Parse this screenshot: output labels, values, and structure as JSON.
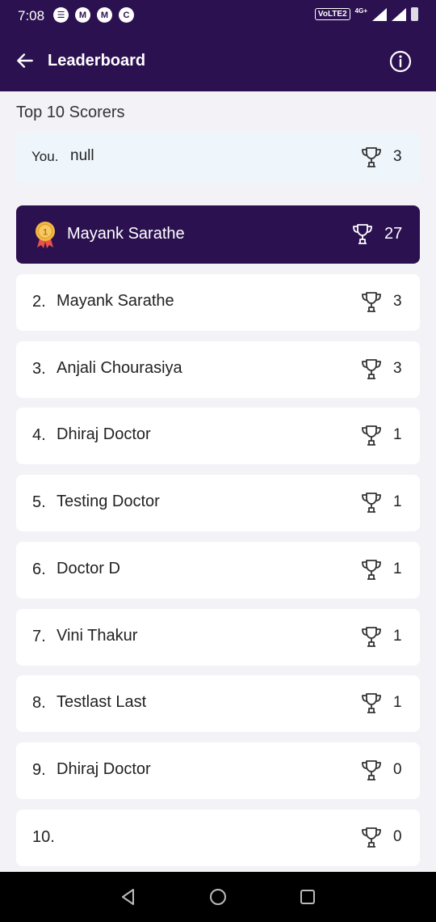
{
  "status_bar": {
    "time": "7:08",
    "notification_icons": [
      "chat-icon",
      "m-icon",
      "m-icon",
      "circle-c-icon"
    ],
    "notification_glyphs": [
      "☰",
      "M",
      "M",
      "C"
    ],
    "volte": "VoLTE2",
    "network": "4G+"
  },
  "header": {
    "title": "Leaderboard",
    "back_icon": "arrow-left-icon",
    "info_icon": "info-icon"
  },
  "section_title": "Top 10 Scorers",
  "you": {
    "label": "You.",
    "value": "null",
    "score": "3"
  },
  "leader": {
    "name": "Mayank Sarathe",
    "score": "27",
    "medal_icon": "gold-medal-icon"
  },
  "entries": [
    {
      "rank": "2.",
      "name": "Mayank Sarathe",
      "score": "3"
    },
    {
      "rank": "3.",
      "name": "Anjali Chourasiya",
      "score": "3"
    },
    {
      "rank": "4.",
      "name": "Dhiraj Doctor",
      "score": "1"
    },
    {
      "rank": "5.",
      "name": "Testing Doctor",
      "score": "1"
    },
    {
      "rank": "6.",
      "name": "Doctor D",
      "score": "1"
    },
    {
      "rank": "7.",
      "name": "Vini Thakur",
      "score": "1"
    },
    {
      "rank": "8.",
      "name": "Testlast Last",
      "score": "1"
    },
    {
      "rank": "9.",
      "name": "Dhiraj Doctor",
      "score": "0"
    },
    {
      "rank": "10.",
      "name": "",
      "score": "0"
    }
  ],
  "colors": {
    "primary": "#2c1150",
    "you_card": "#eef6fc",
    "medal": "#f4b740",
    "ribbon": "#e8524a"
  }
}
